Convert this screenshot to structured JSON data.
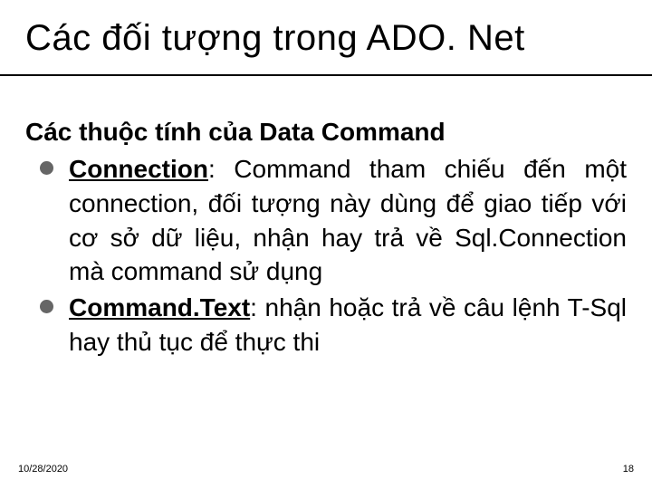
{
  "title": "Các đối tượng trong ADO. Net",
  "subheading": "Các thuộc tính của Data Command",
  "bullets": [
    {
      "term": "Connection",
      "sep": ": ",
      "text": "Command tham chiếu đến một connection, đối tượng này dùng để giao tiếp với cơ sở dữ liệu, nhận hay trả về Sql.Connection mà command sử dụng"
    },
    {
      "term": "Command.Text",
      "sep": ": ",
      "text": "nhận hoặc trả về câu lệnh T-Sql hay thủ tục để thực thi"
    }
  ],
  "footer": {
    "date": "10/28/2020",
    "page": "18"
  }
}
